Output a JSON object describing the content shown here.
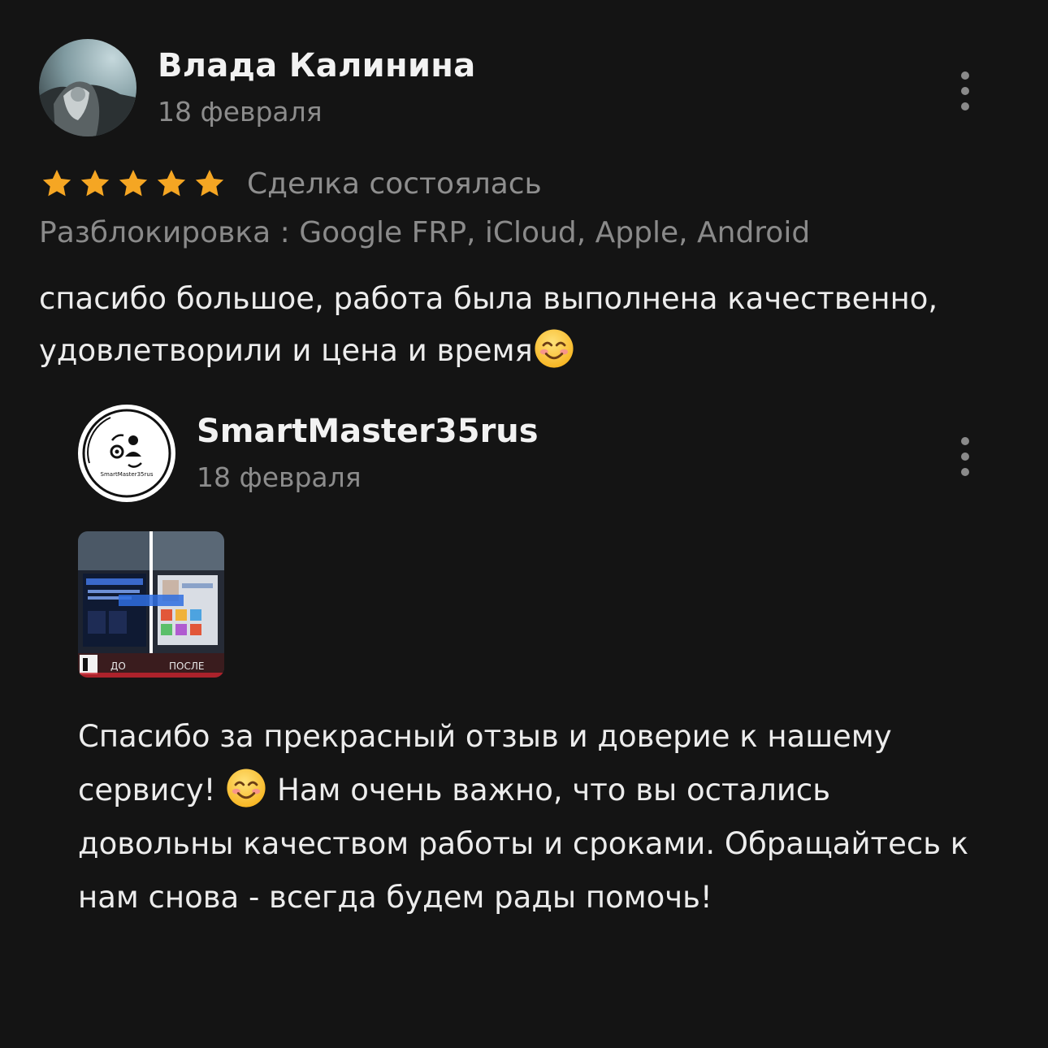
{
  "review": {
    "author": "Влада Калинина",
    "date": "18 февраля",
    "rating": 5,
    "rating_max": 5,
    "deal_status": "Сделка состоялась",
    "service": "Разблокировка : Google FRP, iCloud, Apple, Android",
    "text_before_emoji": "спасибо большое, работа была выполнена качественно, удовлетворили и цена и время",
    "emoji": "smiling-face-emoji"
  },
  "reply": {
    "author": "SmartMaster35rus",
    "date": "18 февраля",
    "photo_labels": {
      "before": "ДО",
      "after": "ПОСЛЕ"
    },
    "logo_text": "SmartMaster35rus",
    "text_part1": "Спасибо за прекрасный отзыв и доверие к нашему сервису! ",
    "text_part2": " Нам очень важно, что вы остались довольны качеством работы и сроками. Обращайтесь к нам снова - всегда будем рады помочь!",
    "emoji": "smiling-face-emoji"
  },
  "colors": {
    "background": "#141414",
    "star": "#f5a623",
    "primary_text": "#ececec",
    "secondary_text": "#8c8c8c"
  },
  "icons": {
    "menu": "more-vertical-icon",
    "star": "star-icon"
  }
}
